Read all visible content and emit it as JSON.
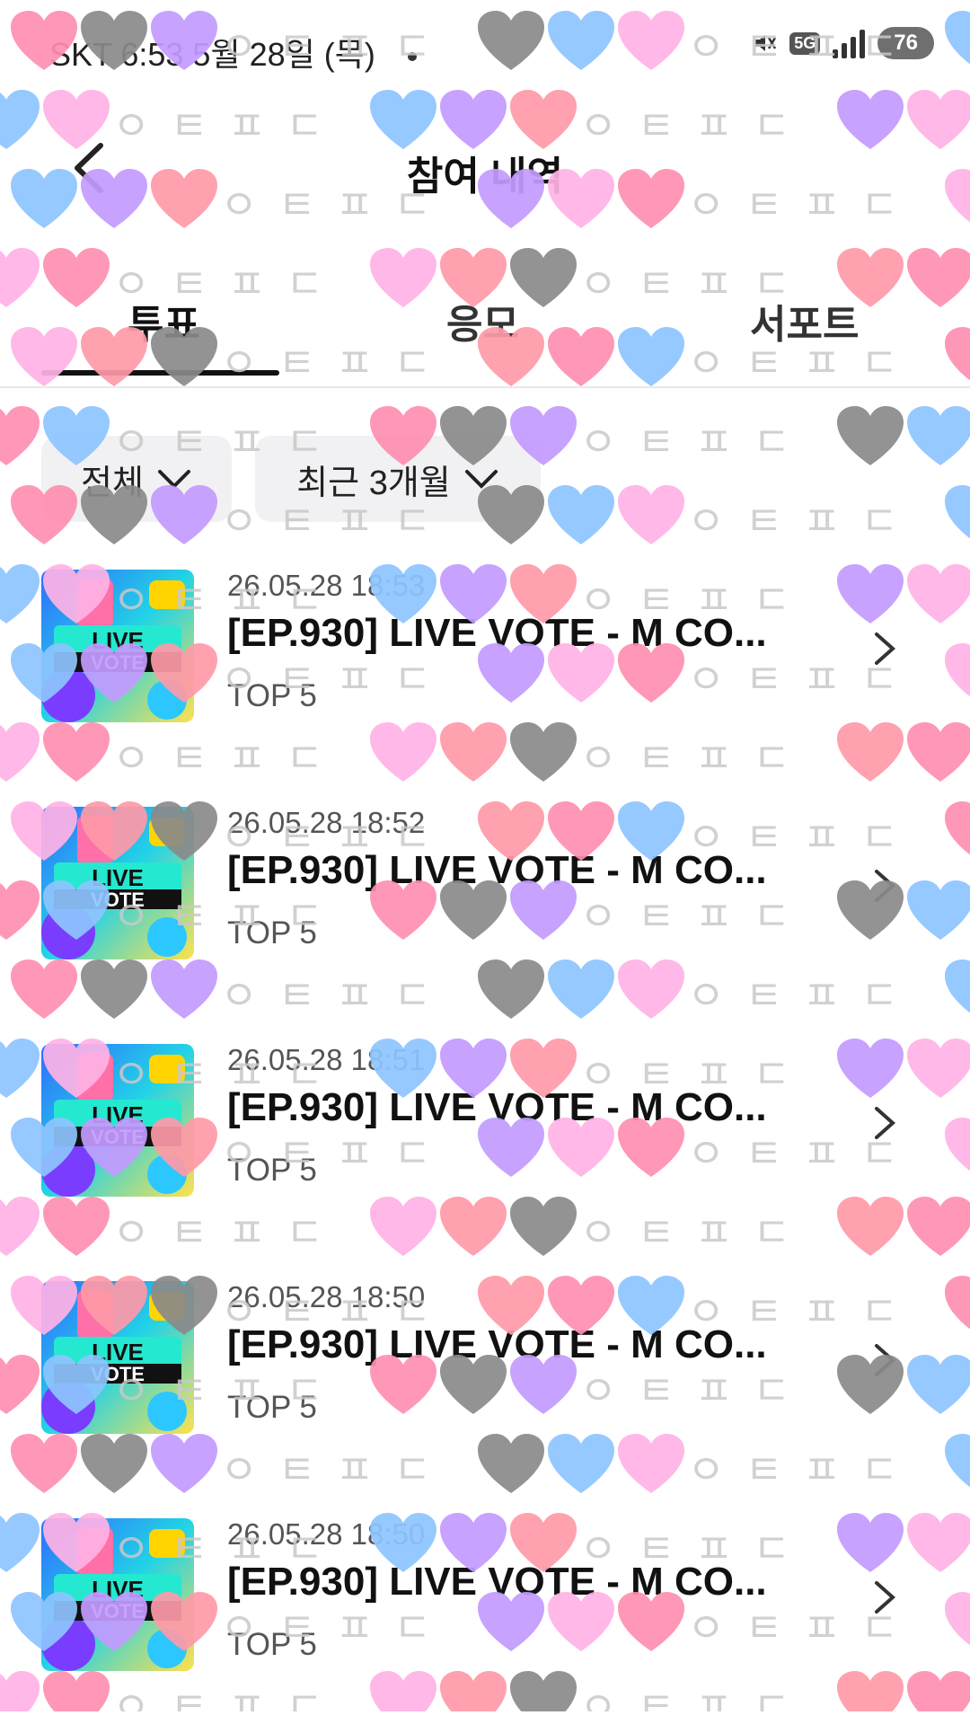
{
  "status_bar": {
    "carrier_time": "SKT 6:53  5월 28일 (목)",
    "network": "5G",
    "battery": "76",
    "icons": [
      "mute-icon",
      "network-5g-icon",
      "signal-icon",
      "battery-icon"
    ]
  },
  "header": {
    "title": "참여 내역",
    "back_icon": "back-arrow-icon"
  },
  "tabs": [
    {
      "label": "투표",
      "active": true
    },
    {
      "label": "응모",
      "active": false
    },
    {
      "label": "서포트",
      "active": false
    }
  ],
  "filters": {
    "category": "전체",
    "period": "최근 3개월"
  },
  "overlay": {
    "text": "ㅇㅌㅍㄷ",
    "heart_colors": [
      "#ff8fb0",
      "#8a8a8a",
      "#8ec5ff",
      "#c39bff",
      "#ffb3e6",
      "#ff9aa8"
    ]
  },
  "items": [
    {
      "date": "26.05.28 18:53",
      "title": "[EP.930] LIVE VOTE - M CO...",
      "sub": "TOP 5"
    },
    {
      "date": "26.05.28 18:52",
      "title": "[EP.930] LIVE VOTE - M CO...",
      "sub": "TOP 5"
    },
    {
      "date": "26.05.28 18:51",
      "title": "[EP.930] LIVE VOTE - M CO...",
      "sub": "TOP 5"
    },
    {
      "date": "26.05.28 18:50",
      "title": "[EP.930] LIVE VOTE - M CO...",
      "sub": "TOP 5"
    },
    {
      "date": "26.05.28 18:50",
      "title": "[EP.930] LIVE VOTE - M CO...",
      "sub": "TOP 5"
    }
  ],
  "thumbnail": {
    "badge_line1": "LIVE",
    "badge_line2": "VOTE"
  }
}
